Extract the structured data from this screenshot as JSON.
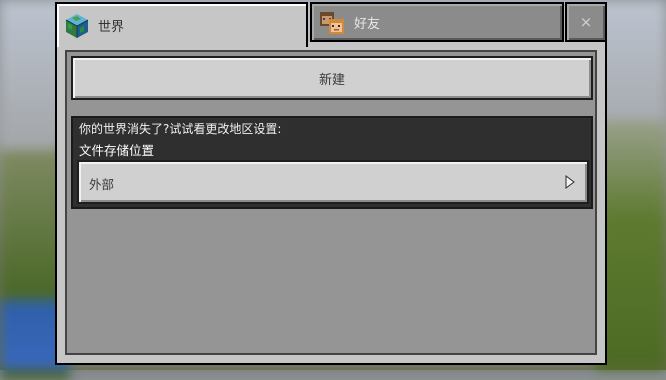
{
  "tabs": {
    "worlds": {
      "label": "世界",
      "icon": "globe-block-icon"
    },
    "friends": {
      "label": "好友",
      "icon": "friends-icon"
    },
    "close": {
      "label": "×"
    }
  },
  "main": {
    "new_button_label": "新建",
    "info": {
      "message": "你的世界消失了?试试看更改地区设置:",
      "subtitle": "文件存储位置",
      "storage_option": "外部",
      "storage_icon": "chevron-right-icon"
    }
  },
  "colors": {
    "panel": "#c6c6c6",
    "inactive_tab": "#8b8b8b",
    "info_box": "#2f2f2f"
  }
}
